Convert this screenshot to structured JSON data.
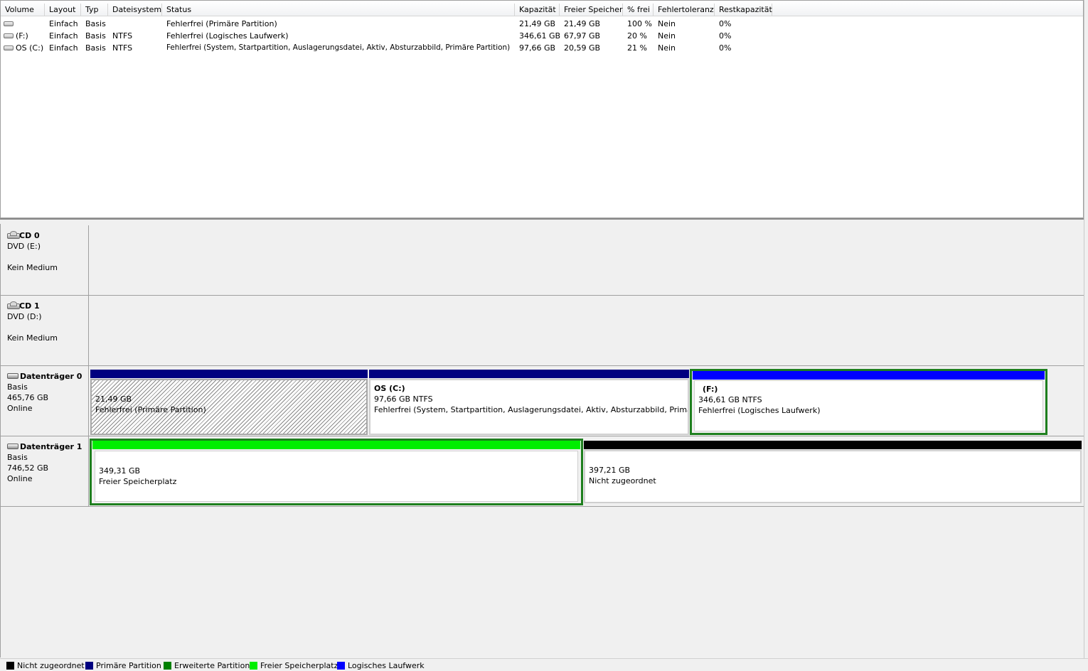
{
  "columns": [
    "Volume",
    "Layout",
    "Typ",
    "Dateisystem",
    "Status",
    "Kapazität",
    "Freier Speicher",
    "% frei",
    "Fehlertoleranz",
    "Restkapazität"
  ],
  "volumes": [
    {
      "volume": "",
      "layout": "Einfach",
      "typ": "Basis",
      "dateisystem": "",
      "status": "Fehlerfrei (Primäre Partition)",
      "kapazitaet": "21,49 GB",
      "frei": "21,49 GB",
      "prozent": "100 %",
      "fehlertoleranz": "Nein",
      "rest": "0%"
    },
    {
      "volume": "(F:)",
      "layout": "Einfach",
      "typ": "Basis",
      "dateisystem": "NTFS",
      "status": "Fehlerfrei (Logisches Laufwerk)",
      "kapazitaet": "346,61 GB",
      "frei": "67,97 GB",
      "prozent": "20 %",
      "fehlertoleranz": "Nein",
      "rest": "0%"
    },
    {
      "volume": "OS (C:)",
      "layout": "Einfach",
      "typ": "Basis",
      "dateisystem": "NTFS",
      "status": "Fehlerfrei (System, Startpartition, Auslagerungsdatei, Aktiv, Absturzabbild, Primäre Partition)",
      "kapazitaet": "97,66 GB",
      "frei": "20,59 GB",
      "prozent": "21 %",
      "fehlertoleranz": "Nein",
      "rest": "0%"
    }
  ],
  "disks": [
    {
      "name": "CD 0",
      "line1": "DVD (E:)",
      "line2": "",
      "line3": "Kein Medium",
      "icon": "cd-drive-icon"
    },
    {
      "name": "CD 1",
      "line1": "DVD (D:)",
      "line2": "",
      "line3": "Kein Medium",
      "icon": "cd-drive-icon"
    },
    {
      "name": "Datenträger 0",
      "line1": "Basis",
      "line2": "465,76 GB",
      "line3": "Online",
      "icon": "hard-disk-icon",
      "partitions": [
        {
          "title": "",
          "size": "21,49 GB",
          "status": "Fehlerfrei (Primäre Partition)",
          "color": "#000080"
        },
        {
          "title": "OS  (C:)",
          "size": "97,66 GB NTFS",
          "status": "Fehlerfrei (System, Startpartition, Auslagerungsdatei, Aktiv, Absturzabbild, Primäre",
          "color": "#000080"
        },
        {
          "title": "(F:)",
          "size": "346,61 GB NTFS",
          "status": "Fehlerfrei (Logisches Laufwerk)",
          "color": "#0000ff"
        }
      ]
    },
    {
      "name": "Datenträger 1",
      "line1": "Basis",
      "line2": "746,52 GB",
      "line3": "Online",
      "icon": "hard-disk-icon",
      "partitions": [
        {
          "title": "",
          "size": "349,31 GB",
          "status": "Freier Speicherplatz",
          "color": "#00ee00"
        },
        {
          "title": "",
          "size": "397,21 GB",
          "status": "Nicht zugeordnet",
          "color": "#000000"
        }
      ]
    }
  ],
  "legend": [
    {
      "label": "Nicht zugeordnet",
      "color": "#000000"
    },
    {
      "label": "Primäre Partition",
      "color": "#000080"
    },
    {
      "label": "Erweiterte Partition",
      "color": "#008000"
    },
    {
      "label": "Freier Speicherplatz",
      "color": "#00ee00"
    },
    {
      "label": "Logisches Laufwerk",
      "color": "#0000ff"
    }
  ]
}
